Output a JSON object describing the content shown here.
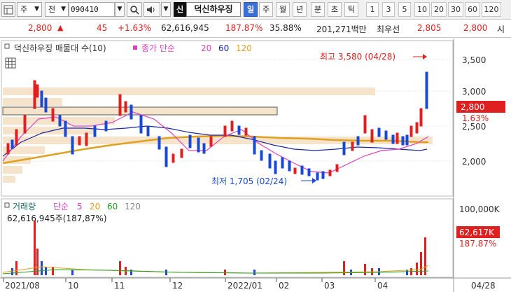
{
  "toolbar": {
    "market_label": "주",
    "type_label": "전",
    "code": "090410",
    "badge": "신",
    "stock_name": "덕신하우징",
    "periods": [
      "일",
      "주",
      "월",
      "년",
      "분",
      "초",
      "틱"
    ],
    "active_period": "일",
    "numbers": [
      "1",
      "3",
      "5",
      "10",
      "20",
      "30",
      "60",
      "120"
    ]
  },
  "quote": {
    "price": "2,800",
    "change": "45",
    "change_pct": "+1.63%",
    "volume": "62,616,945",
    "volume_ratio": "187.87%",
    "turnover": "35.88%",
    "amount": "201,271백만",
    "best_offer_label": "최우선",
    "ask": "2,805",
    "bid": "2,800",
    "unit": "시"
  },
  "price_chart": {
    "legend_title": "덕신하우징 매물대 수(10)",
    "ma_label": "종가 단순",
    "ma_periods": [
      "20",
      "60",
      "120"
    ],
    "high_label": "최고 3,580 (04/28)",
    "low_label": "최저 1,705 (02/24)",
    "axis": [
      "3,500",
      "3,000",
      "2,500",
      "2,000"
    ],
    "current_price": "2,800",
    "current_pct": "1.63%"
  },
  "volume_chart": {
    "legend_title": "거래량",
    "ma_label": "단순",
    "ma_periods": [
      "5",
      "20",
      "60",
      "120"
    ],
    "current_text": "62,616,945주(187,87%)",
    "axis_top": "100,000K",
    "current_value": "62,617K",
    "current_pct": "187.87%"
  },
  "x_axis": [
    "2021/08",
    "10",
    "11",
    "12",
    "2022/01",
    "02",
    "03",
    "04",
    "04/28"
  ],
  "colors": {
    "up": "#e02020",
    "down": "#1848d8",
    "ma20": "#e040c0",
    "ma60": "#1a2aa0",
    "ma120": "#e0a020",
    "band": "#f5e3cc"
  }
}
